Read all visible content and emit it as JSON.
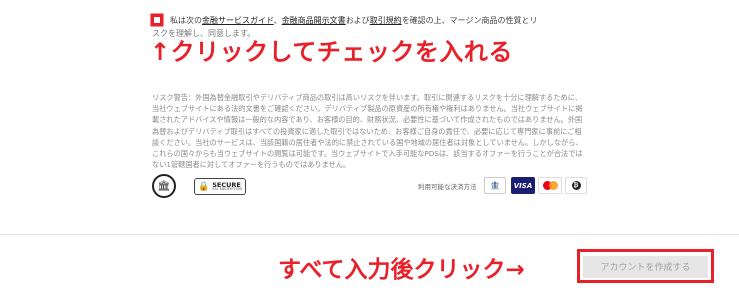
{
  "consent": {
    "prefix": "私は次の",
    "link1": "金融サービスガイド",
    "sep1": "、",
    "link2": "金融商品開示文書",
    "mid": "および",
    "link3": "取引規約",
    "suffix": "を確認の上、マージン商品の性質とリ",
    "line2": "スクを理解し、同意します。"
  },
  "annotations": {
    "check": "↑クリックしてチェックを入れる",
    "submit": "すべて入力後クリック→"
  },
  "risk_warning": "リスク警告：外国為替金融取引やデリバティブ商品の取引は高いリスクを伴います。取引に関連するリスクを十分に理解するために、当社ウェブサイトにある法的文書をご確認ください。デリバティブ製品の原資産の所有権や権利はありません。当社ウェブサイトに掲載されたアドバイスや情報は一般的な内容であり、お客様の目的、財務状況、必要性に基づいて作成されたものではありません。外国為替およびデリバティブ取引はすべての投資家に適した取引ではないため、お客様ご自身の責任で、必要に応じて専門家に事前にご相談ください。当社のサービスは、当該国籍の居住者や法的に禁止されている国や地域の居住者は対象としていません。しかしながら、これらの国々からも当ウェブサイトの閲覧は可能です。当ウェブサイトで入手可能なPDSは、該当するオファーを行うことが合法ではない1管轄国者に対してオファーを行うものではありません。",
  "badges": {
    "secure_title": "SECURE",
    "secure_sub": "SSL ENCRYPTION"
  },
  "payment": {
    "label": "利用可能な決済方法",
    "visa": "VISA"
  },
  "submit": {
    "label": "アカウントを作成する"
  },
  "colors": {
    "accent": "#e8202a",
    "visa": "#1a1f71",
    "button_bg": "#e6e6e6",
    "button_text": "#a3a3a3"
  }
}
